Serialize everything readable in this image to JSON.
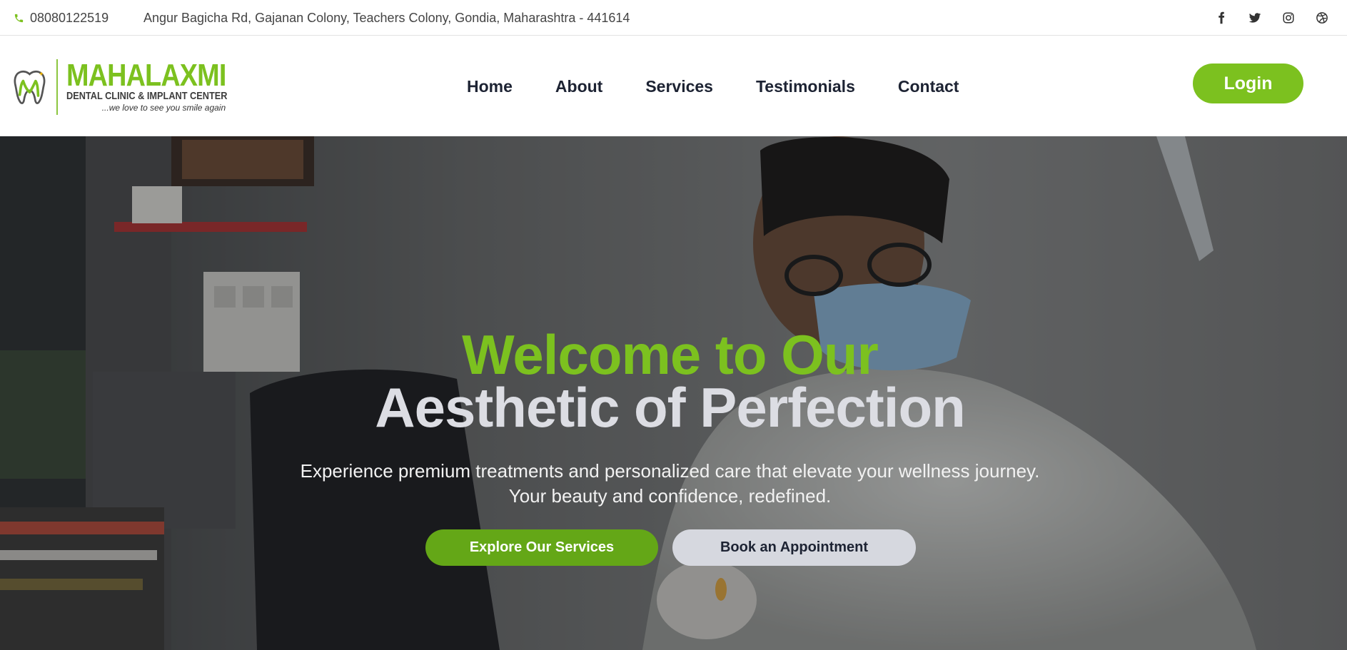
{
  "topbar": {
    "phone": "08080122519",
    "address": "Angur Bagicha Rd, Gajanan Colony, Teachers Colony, Gondia, Maharashtra - 441614",
    "social": [
      {
        "icon": "facebook-icon"
      },
      {
        "icon": "twitter-icon"
      },
      {
        "icon": "instagram-icon"
      },
      {
        "icon": "dribbble-icon"
      }
    ]
  },
  "logo": {
    "name": "MAHALAXMI",
    "subtitle": "DENTAL CLINIC & IMPLANT CENTER",
    "tagline": "...we love to see you smile again"
  },
  "nav": {
    "items": [
      "Home",
      "About",
      "Services",
      "Testimonials",
      "Contact"
    ],
    "login_label": "Login"
  },
  "hero": {
    "heading_line1": "Welcome to Our",
    "heading_line2": "Aesthetic of Perfection",
    "description": "Experience premium treatments and personalized care that elevate your wellness journey. Your beauty and confidence, redefined.",
    "primary_button": "Explore Our Services",
    "secondary_button": "Book an Appointment"
  },
  "colors": {
    "accent": "#7cc11f",
    "accent_dark": "#64a717",
    "text_dark": "#1d2333"
  }
}
